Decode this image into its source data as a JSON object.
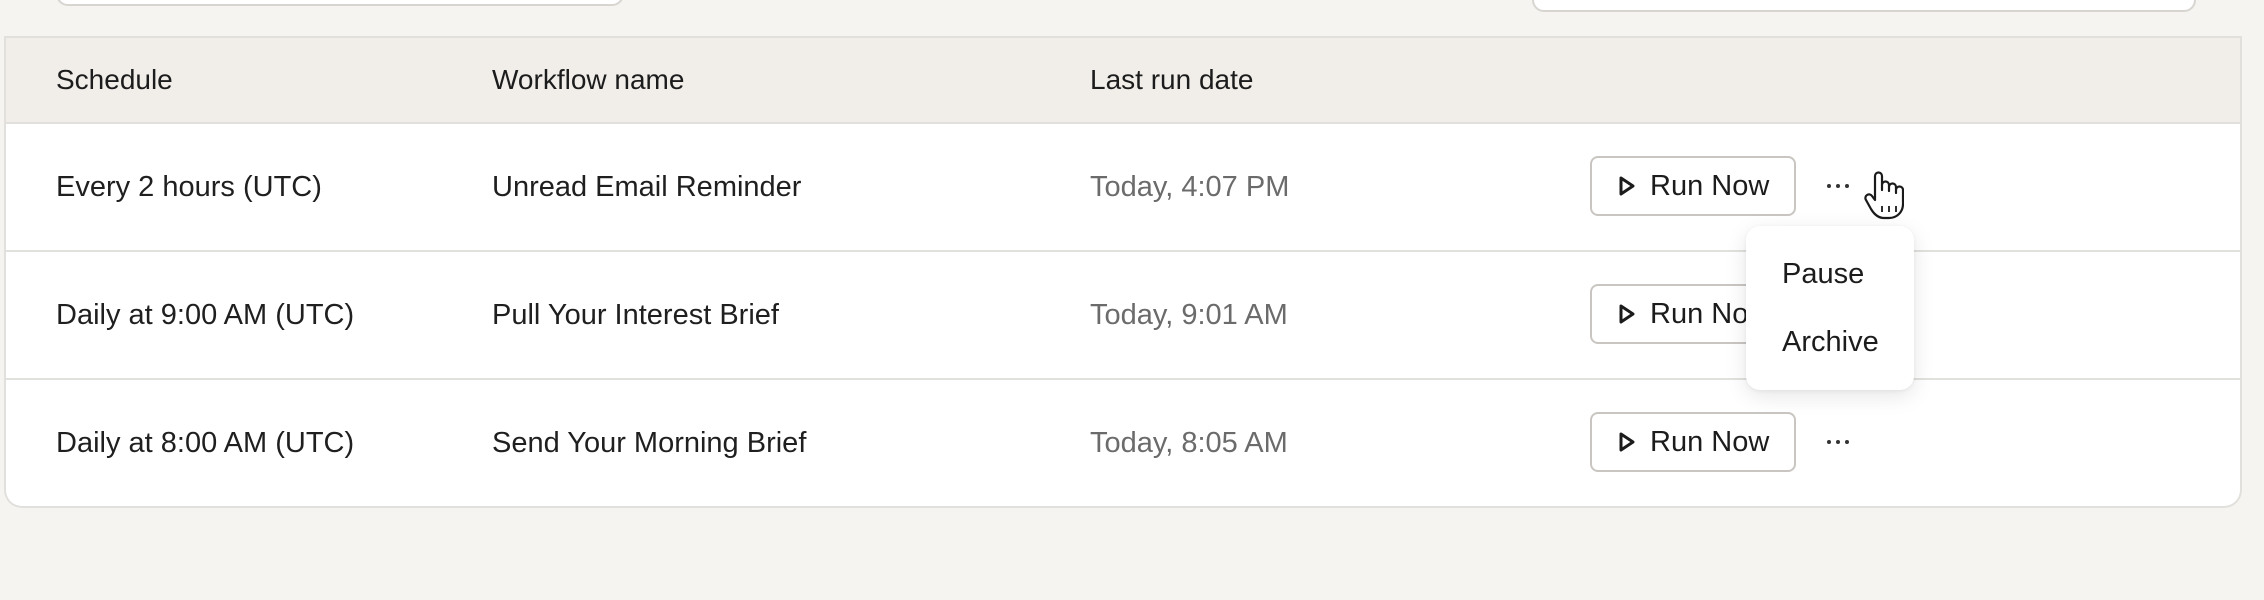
{
  "table": {
    "headers": {
      "schedule": "Schedule",
      "workflow": "Workflow name",
      "last_run": "Last run date"
    },
    "rows": [
      {
        "schedule": "Every 2 hours (UTC)",
        "workflow": "Unread Email Reminder",
        "last_run": "Today, 4:07 PM",
        "action_label": "Run Now"
      },
      {
        "schedule": "Daily at 9:00 AM (UTC)",
        "workflow": "Pull Your Interest Brief",
        "last_run": "Today, 9:01 AM",
        "action_label": "Run Now"
      },
      {
        "schedule": "Daily at 8:00 AM (UTC)",
        "workflow": "Send Your Morning Brief",
        "last_run": "Today, 8:05 AM",
        "action_label": "Run Now"
      }
    ]
  },
  "row_menu": {
    "items": [
      "Pause",
      "Archive"
    ]
  },
  "icons": {
    "run": "play-icon",
    "more": "ellipsis-icon",
    "cursor": "hand-pointer-cursor"
  }
}
